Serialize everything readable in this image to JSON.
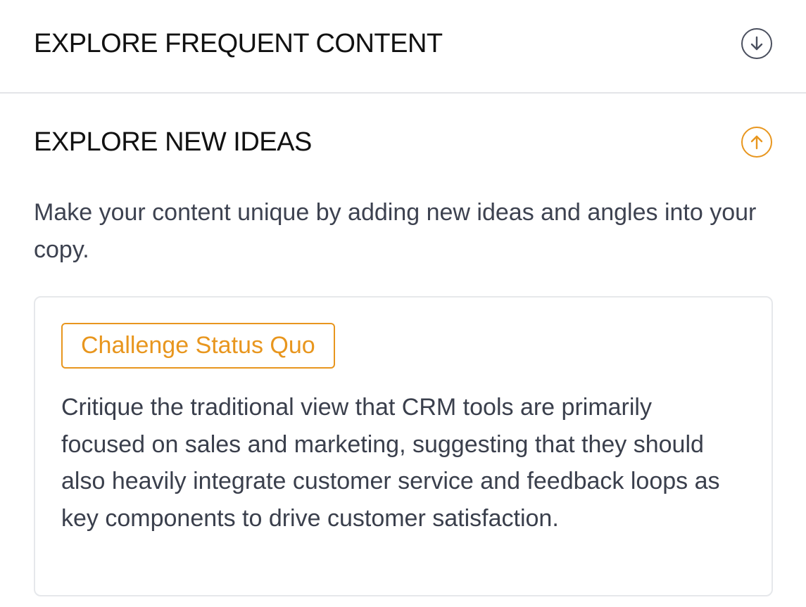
{
  "sections": [
    {
      "title": "EXPLORE FREQUENT CONTENT",
      "toggle_icon": "arrow-down-circle-icon",
      "expanded": false,
      "icon_color": "#4a4f5e"
    },
    {
      "title": "EXPLORE NEW IDEAS",
      "toggle_icon": "arrow-up-circle-icon",
      "expanded": true,
      "icon_color": "#e8961e",
      "description": "Make your content unique by adding new ideas and angles into your copy.",
      "cards": [
        {
          "tag": "Challenge Status Quo",
          "text": "Critique the traditional view that CRM tools are primarily focused on sales and marketing, suggesting that they should also heavily integrate customer service and feedback loops as key components to drive customer satisfaction."
        }
      ]
    }
  ],
  "colors": {
    "accent": "#e8961e",
    "text_primary": "#111111",
    "text_body": "#3a3f4c",
    "border": "#e6e8eb"
  }
}
